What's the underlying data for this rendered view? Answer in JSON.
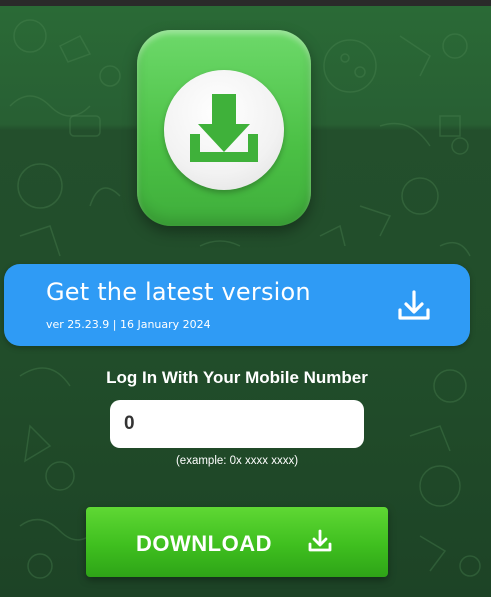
{
  "colors": {
    "background": "#214d2a",
    "banner": "#2f9bf5",
    "icon_green": "#4bc045",
    "button_green": "#3fbf1f"
  },
  "app_icon": {
    "name": "download-icon"
  },
  "latest": {
    "title": "Get the latest version",
    "version_line": "ver 25.23.9 | 16 January 2024",
    "icon": "download-icon"
  },
  "login": {
    "heading": "Log In With Your Mobile Number",
    "phone_value": "0",
    "example": "(example: 0x xxxx xxxx)"
  },
  "download": {
    "label": "DOWNLOAD",
    "icon": "download-icon"
  }
}
